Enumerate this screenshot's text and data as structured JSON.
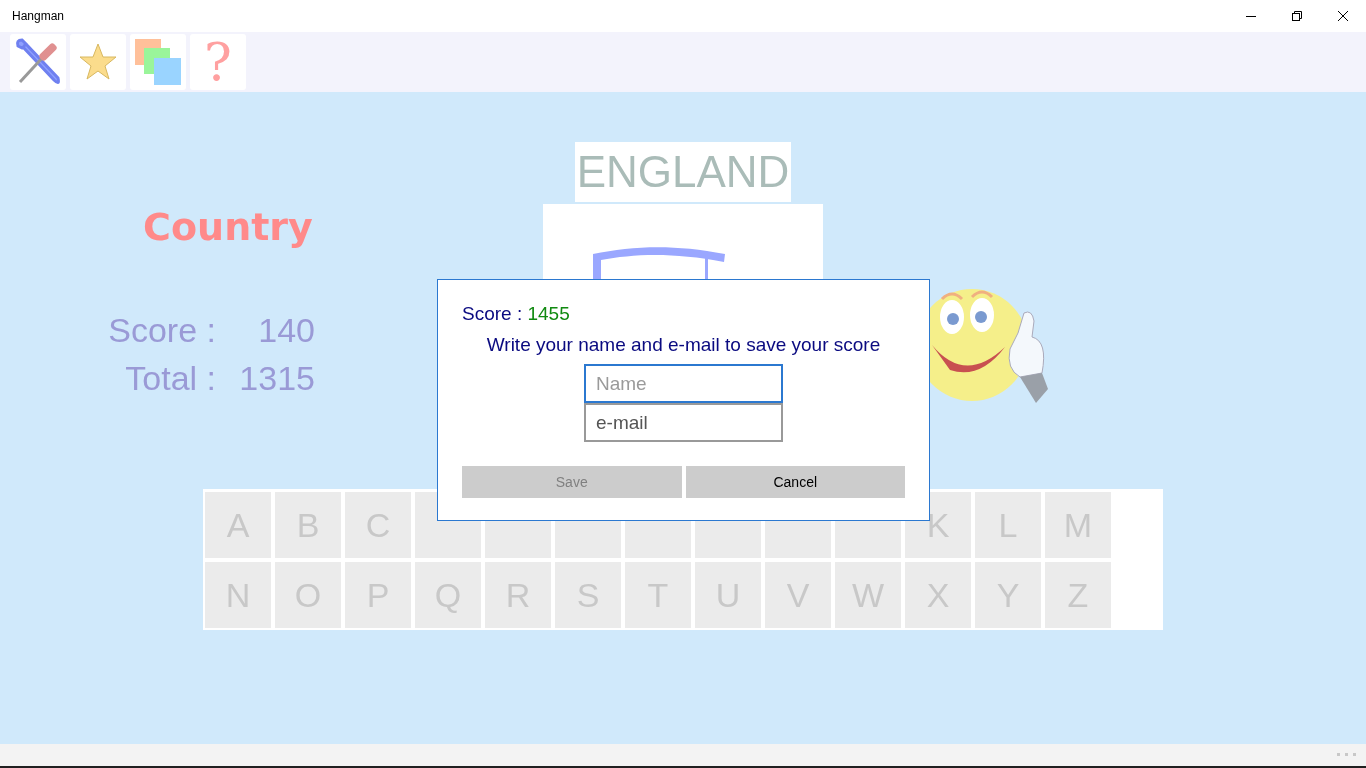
{
  "window": {
    "title": "Hangman"
  },
  "toolbar": [
    {
      "kind": "tools"
    },
    {
      "kind": "star"
    },
    {
      "kind": "layers"
    },
    {
      "kind": "help",
      "glyph": "?"
    }
  ],
  "category": "Country",
  "scores": [
    {
      "label": "Score :",
      "value": "140"
    },
    {
      "label": "Total :",
      "value": "1315"
    }
  ],
  "word": "ENGLAND",
  "keys": [
    {
      "letter": "A",
      "disabled": true
    },
    {
      "letter": "B",
      "disabled": true
    },
    {
      "letter": "C",
      "disabled": true
    },
    {
      "disabled": true
    },
    {
      "disabled": true
    },
    {
      "disabled": true
    },
    {
      "disabled": true
    },
    {
      "disabled": true
    },
    {
      "disabled": true
    },
    {
      "disabled": true
    },
    {
      "letter": "K",
      "disabled": true
    },
    {
      "letter": "L",
      "disabled": true
    },
    {
      "letter": "M",
      "disabled": true
    },
    {
      "letter": "N",
      "disabled": true
    },
    {
      "letter": "O",
      "disabled": true
    },
    {
      "letter": "P",
      "disabled": true
    },
    {
      "letter": "Q",
      "disabled": true
    },
    {
      "letter": "R",
      "disabled": true
    },
    {
      "letter": "S",
      "disabled": true
    },
    {
      "letter": "T",
      "disabled": true
    },
    {
      "letter": "U",
      "disabled": true
    },
    {
      "letter": "V",
      "disabled": true
    },
    {
      "letter": "W",
      "disabled": true
    },
    {
      "letter": "X",
      "disabled": true
    },
    {
      "letter": "Y",
      "disabled": true
    },
    {
      "letter": "Z",
      "disabled": true
    }
  ],
  "dialog": {
    "score_label": "Score :",
    "score_value": "1455",
    "message": "Write your name and e-mail to save your score",
    "fields": [
      {
        "placeholder": "Name",
        "focused": true
      },
      {
        "placeholder": "e-mail",
        "focused": false
      }
    ],
    "buttons": [
      {
        "label": "Save",
        "disabled": true
      },
      {
        "label": "Cancel",
        "disabled": false
      }
    ]
  }
}
